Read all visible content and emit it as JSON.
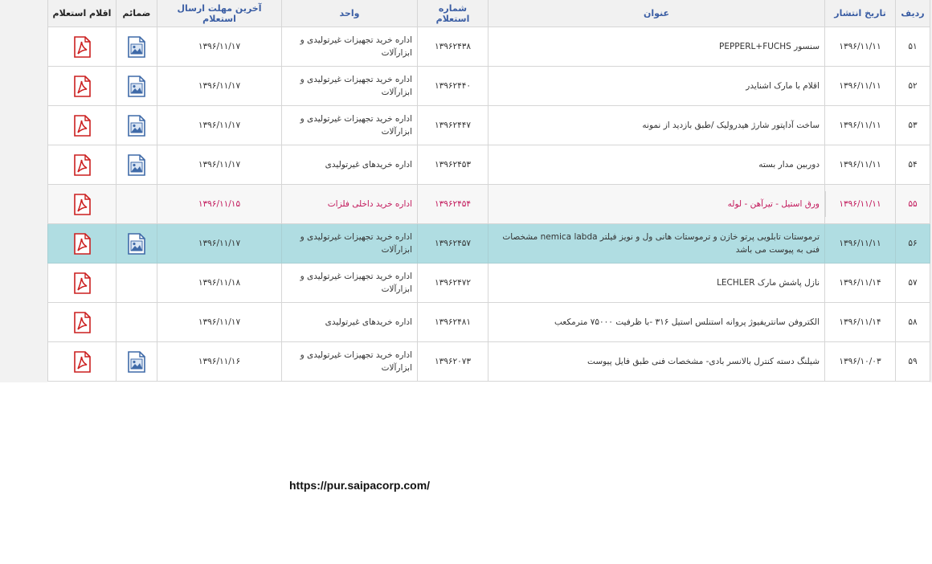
{
  "headers": {
    "radif": "ردیف",
    "date": "تاریخ انتشار",
    "title": "عنوان",
    "number": "شماره استعلام",
    "unit": "واحد",
    "deadline": "آخرین مهلت ارسال استعلام",
    "attachments": "ضمائم",
    "items": "اقلام استعلام"
  },
  "rows": [
    {
      "radif": "۵۱",
      "date": "۱۳۹۶/۱۱/۱۱",
      "title": "سنسور PEPPERL+FUCHS",
      "number": "۱۳۹۶۲۴۳۸",
      "unit": "اداره خرید تجهیزات غیرتولیدی و ابزارآلات",
      "deadline": "۱۳۹۶/۱۱/۱۷",
      "has_attachment": true
    },
    {
      "radif": "۵۲",
      "date": "۱۳۹۶/۱۱/۱۱",
      "title": "اقلام با مارک اشنایدر",
      "number": "۱۳۹۶۲۴۴۰",
      "unit": "اداره خرید تجهیزات غیرتولیدی و ابزارآلات",
      "deadline": "۱۳۹۶/۱۱/۱۷",
      "has_attachment": true
    },
    {
      "radif": "۵۳",
      "date": "۱۳۹۶/۱۱/۱۱",
      "title": "ساخت آداپتور شارژ هیدرولیک /طبق بازدید از نمونه",
      "number": "۱۳۹۶۲۴۴۷",
      "unit": "اداره خرید تجهیزات غیرتولیدی و ابزارآلات",
      "deadline": "۱۳۹۶/۱۱/۱۷",
      "has_attachment": true
    },
    {
      "radif": "۵۴",
      "date": "۱۳۹۶/۱۱/۱۱",
      "title": "دوربین مدار بسته",
      "number": "۱۳۹۶۲۴۵۳",
      "unit": "اداره خریدهای غیرتولیدی",
      "deadline": "۱۳۹۶/۱۱/۱۷",
      "has_attachment": true
    },
    {
      "radif": "۵۵",
      "date": "۱۳۹۶/۱۱/۱۱",
      "title": "ورق استیل - تیرآهن - لوله",
      "number": "۱۳۹۶۲۴۵۴",
      "unit": "اداره خرید داخلی فلزات",
      "deadline": "۱۳۹۶/۱۱/۱۵",
      "has_attachment": false
    },
    {
      "radif": "۵۶",
      "date": "۱۳۹۶/۱۱/۱۱",
      "title": "ترموستات تابلویی پرتو خازن و ترموستات هانی ول و نویز فیلتر nemica labda مشخصات فنی به پیوست می باشد",
      "number": "۱۳۹۶۲۴۵۷",
      "unit": "اداره خرید تجهیزات غیرتولیدی و ابزارآلات",
      "deadline": "۱۳۹۶/۱۱/۱۷",
      "has_attachment": true
    },
    {
      "radif": "۵۷",
      "date": "۱۳۹۶/۱۱/۱۴",
      "title": "نازل پاشش مارک LECHLER",
      "number": "۱۳۹۶۲۴۷۲",
      "unit": "اداره خرید تجهیزات غیرتولیدی و ابزارآلات",
      "deadline": "۱۳۹۶/۱۱/۱۸",
      "has_attachment": false
    },
    {
      "radif": "۵۸",
      "date": "۱۳۹۶/۱۱/۱۴",
      "title": "الکتروفن سانتریفیوژ پروانه استنلس استیل ۳۱۶ -با ظرفیت ۷۵۰۰۰ مترمکعب",
      "number": "۱۳۹۶۲۴۸۱",
      "unit": "اداره خریدهای غیرتولیدی",
      "deadline": "۱۳۹۶/۱۱/۱۷",
      "has_attachment": false
    },
    {
      "radif": "۵۹",
      "date": "۱۳۹۶/۱۰/۰۳",
      "title": "شیلنگ دسته کنترل بالانسر بادی- مشخصات فنی طبق فایل پیوست",
      "number": "۱۳۹۶۲۰۷۳",
      "unit": "اداره خرید تجهیزات غیرتولیدی و ابزارآلات",
      "deadline": "۱۳۹۶/۱۱/۱۶",
      "has_attachment": true
    }
  ],
  "footer_url": "https://pur.saipacorp.com/",
  "colors": {
    "header_text": "#3b5ea4",
    "selected_row": "#b0dde2",
    "red_row_text": "#c2185b",
    "pdf_red": "#cc1f1f",
    "image_icon_blue": "#3f6aa8"
  },
  "icons": {
    "items": "pdf-icon",
    "attachments": "image-file-icon"
  }
}
